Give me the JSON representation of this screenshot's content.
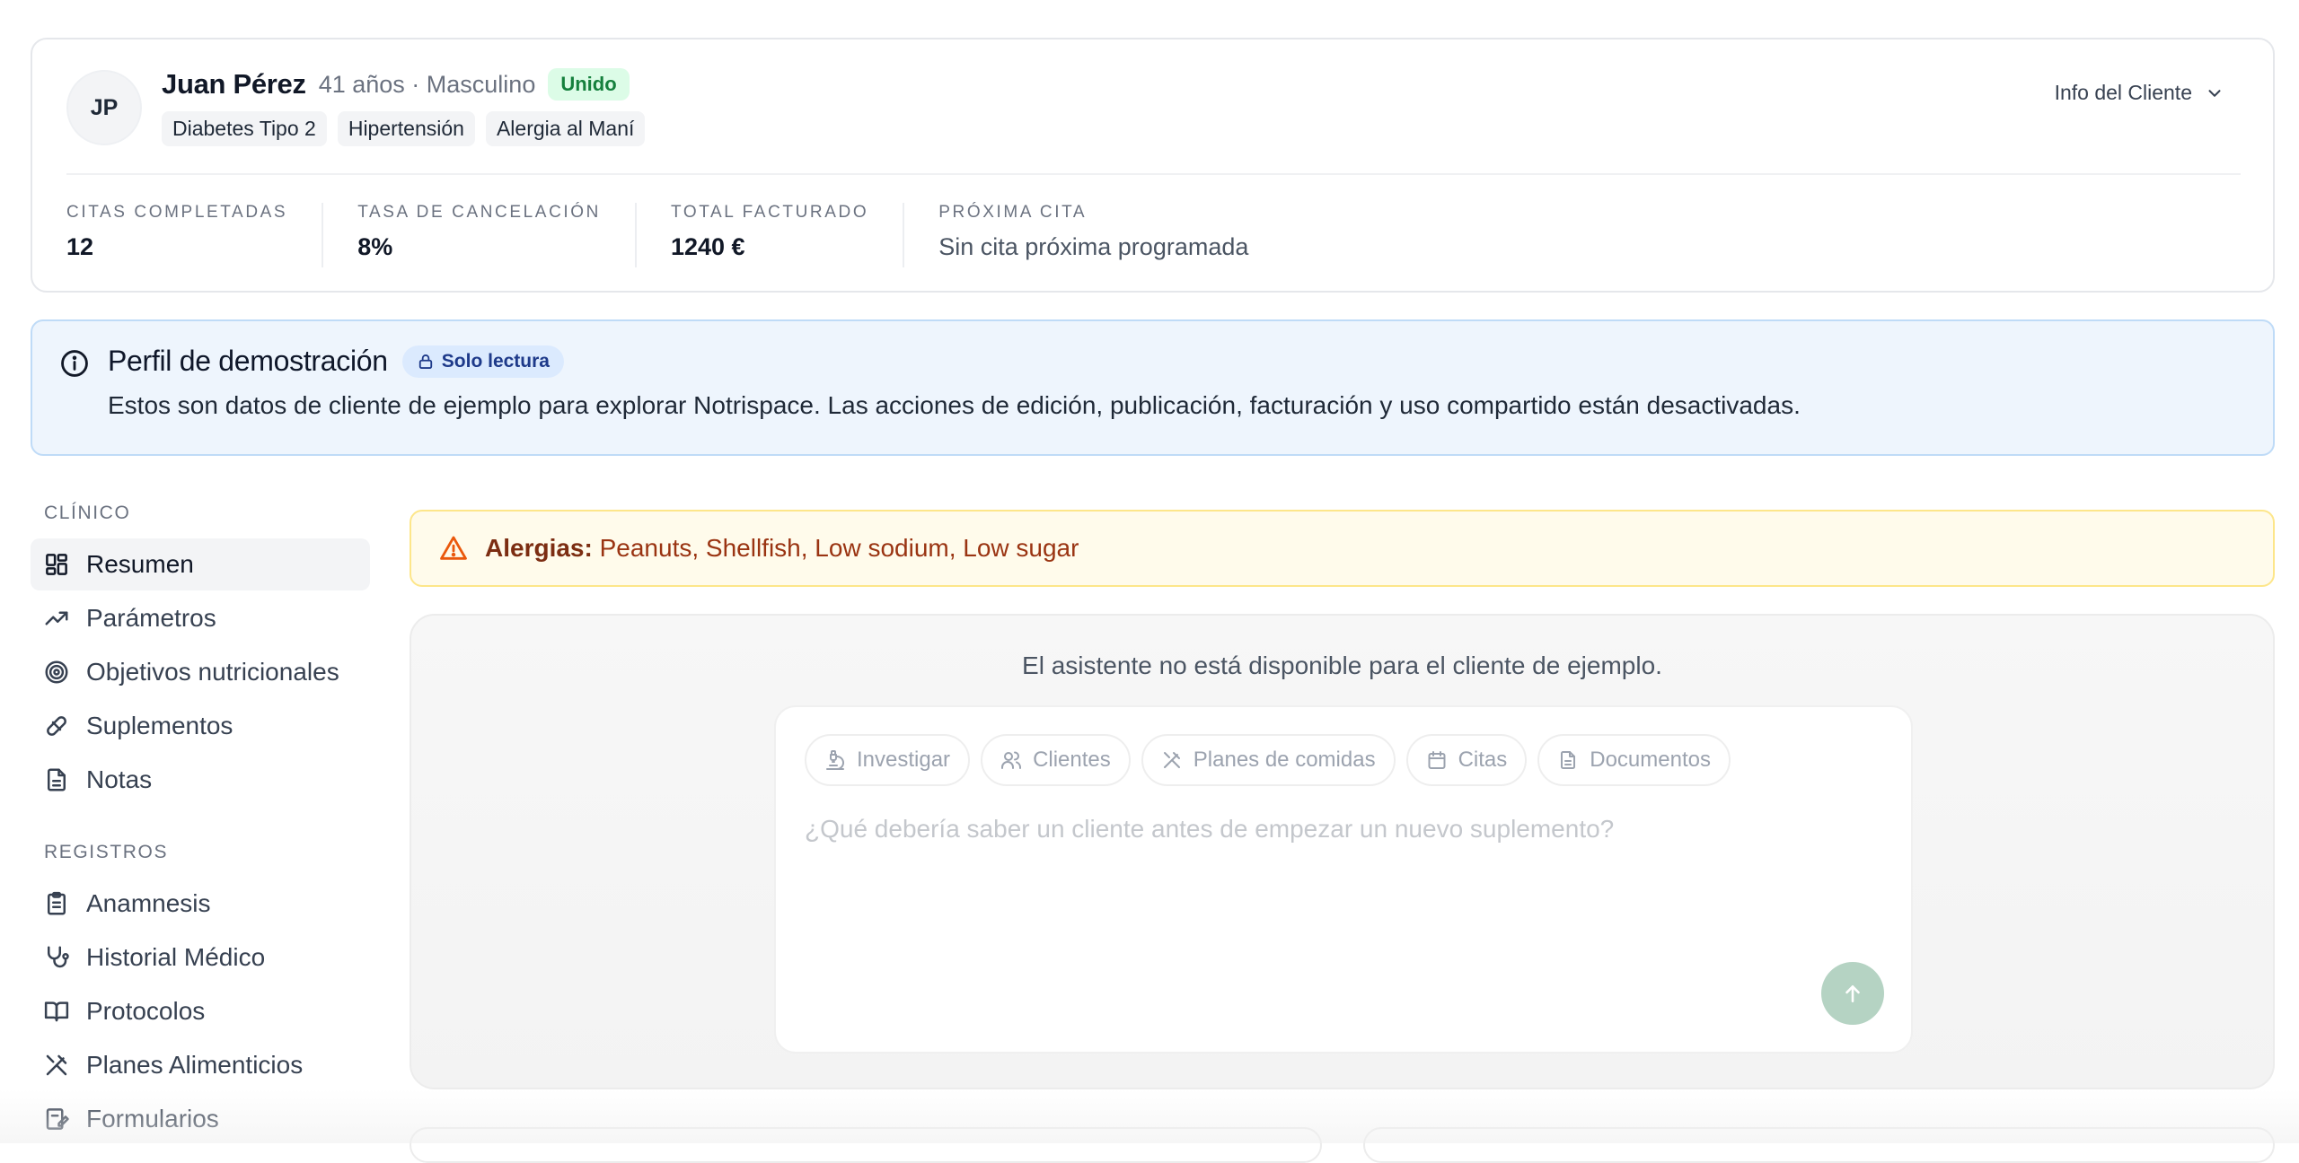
{
  "client": {
    "initials": "JP",
    "name": "Juan Pérez",
    "meta": "41 años · Masculino",
    "status_badge": "Unido",
    "tags": [
      "Diabetes Tipo 2",
      "Hipertensión",
      "Alergia al Maní"
    ],
    "info_toggle_label": "Info del Cliente"
  },
  "stats": [
    {
      "label": "Citas completadas",
      "value": "12"
    },
    {
      "label": "Tasa de cancelación",
      "value": "8%"
    },
    {
      "label": "Total facturado",
      "value": "1240 €"
    },
    {
      "label": "Próxima cita",
      "value": "Sin cita próxima programada"
    }
  ],
  "demo_banner": {
    "title": "Perfil de demostración",
    "badge": "Solo lectura",
    "text": "Estos son datos de cliente de ejemplo para explorar Notrispace. Las acciones de edición, publicación, facturación y uso compartido están desactivadas."
  },
  "sidebar": {
    "clinical_label": "Clínico",
    "clinical_items": [
      {
        "label": "Resumen",
        "icon": "grid-icon",
        "active": true
      },
      {
        "label": "Parámetros",
        "icon": "trending-up-icon"
      },
      {
        "label": "Objetivos nutricionales",
        "icon": "target-icon"
      },
      {
        "label": "Suplementos",
        "icon": "pill-icon"
      },
      {
        "label": "Notas",
        "icon": "file-text-icon"
      }
    ],
    "records_label": "Registros",
    "records_items": [
      {
        "label": "Anamnesis",
        "icon": "clipboard-icon"
      },
      {
        "label": "Historial Médico",
        "icon": "stethoscope-icon"
      },
      {
        "label": "Protocolos",
        "icon": "book-icon"
      },
      {
        "label": "Planes Alimenticios",
        "icon": "utensils-icon"
      },
      {
        "label": "Formularios",
        "icon": "form-icon"
      }
    ]
  },
  "allergy_alert": {
    "label": "Alergias:",
    "list": "Peanuts, Shellfish, Low sodium, Low sugar"
  },
  "assistant": {
    "unavailable_text": "El asistente no está disponible para el cliente de ejemplo.",
    "chips": [
      {
        "label": "Investigar",
        "icon": "microscope-icon"
      },
      {
        "label": "Clientes",
        "icon": "users-icon"
      },
      {
        "label": "Planes de comidas",
        "icon": "utensils-icon"
      },
      {
        "label": "Citas",
        "icon": "calendar-icon"
      },
      {
        "label": "Documentos",
        "icon": "document-icon"
      }
    ],
    "input_placeholder": "¿Qué debería saber un cliente antes de empezar un nuevo suplemento?"
  },
  "colors": {
    "joined_badge_bg": "#dcfce7",
    "banner_bg": "#eef5fd",
    "alert_bg": "#fffbeb",
    "send_button": "#b5d3c3"
  }
}
